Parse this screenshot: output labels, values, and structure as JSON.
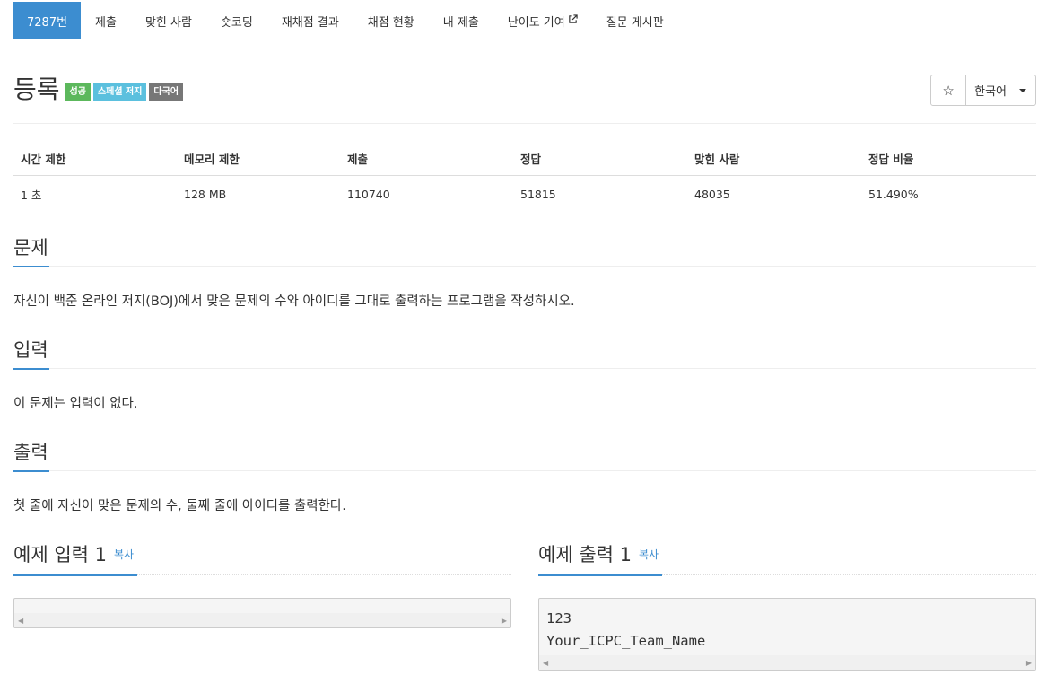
{
  "nav": {
    "items": [
      "7287번",
      "제출",
      "맞힌 사람",
      "숏코딩",
      "재채점 결과",
      "채점 현황",
      "내 제출",
      "난이도 기여",
      "질문 게시판"
    ],
    "external_icon": "external-link-icon"
  },
  "problem": {
    "title": "등록",
    "labels": [
      "성공",
      "스페셜 저지",
      "다국어"
    ],
    "star_icon": "☆",
    "language": "한국어"
  },
  "info": {
    "headers": [
      "시간 제한",
      "메모리 제한",
      "제출",
      "정답",
      "맞힌 사람",
      "정답 비율"
    ],
    "values": [
      "1 초",
      "128 MB",
      "110740",
      "51815",
      "48035",
      "51.490%"
    ]
  },
  "sections": {
    "description": {
      "title": "문제",
      "text": "자신이 백준 온라인 저지(BOJ)에서 맞은 문제의 수와 아이디를 그대로 출력하는 프로그램을 작성하시오."
    },
    "input": {
      "title": "입력",
      "text": "이 문제는 입력이 없다."
    },
    "output": {
      "title": "출력",
      "text": "첫 줄에 자신이 맞은 문제의 수, 둘째 줄에 아이디를 출력한다."
    }
  },
  "samples": {
    "input": {
      "title": "예제 입력 1",
      "copy": "복사",
      "content": ""
    },
    "output": {
      "title": "예제 출력 1",
      "copy": "복사",
      "content": "123\nYour_ICPC_Team_Name"
    }
  },
  "colors": {
    "accent": "#3c8dd0",
    "success": "#5cb85c",
    "info": "#5bc0de",
    "default": "#777777"
  }
}
